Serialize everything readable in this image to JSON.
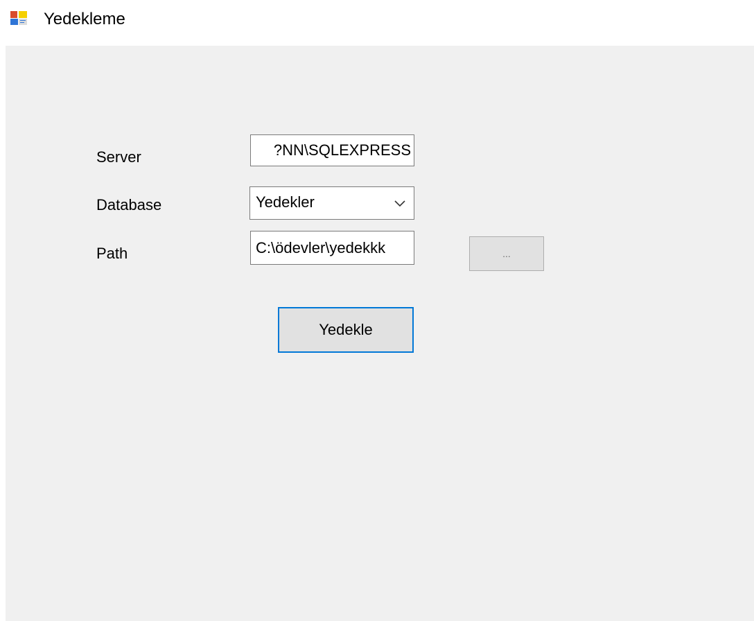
{
  "window": {
    "title": "Yedekleme",
    "icon": "windows-form-icon"
  },
  "form": {
    "server": {
      "label": "Server",
      "value": "?NN\\SQLEXPRESS"
    },
    "database": {
      "label": "Database",
      "selected": "Yedekler"
    },
    "path": {
      "label": "Path",
      "value": "C:\\ödevler\\yedekkk"
    },
    "browse_button_label": "...",
    "backup_button_label": "Yedekle"
  },
  "colors": {
    "client_background": "#f0f0f0",
    "focus_border": "#0078d7",
    "button_background": "#e1e1e1"
  }
}
